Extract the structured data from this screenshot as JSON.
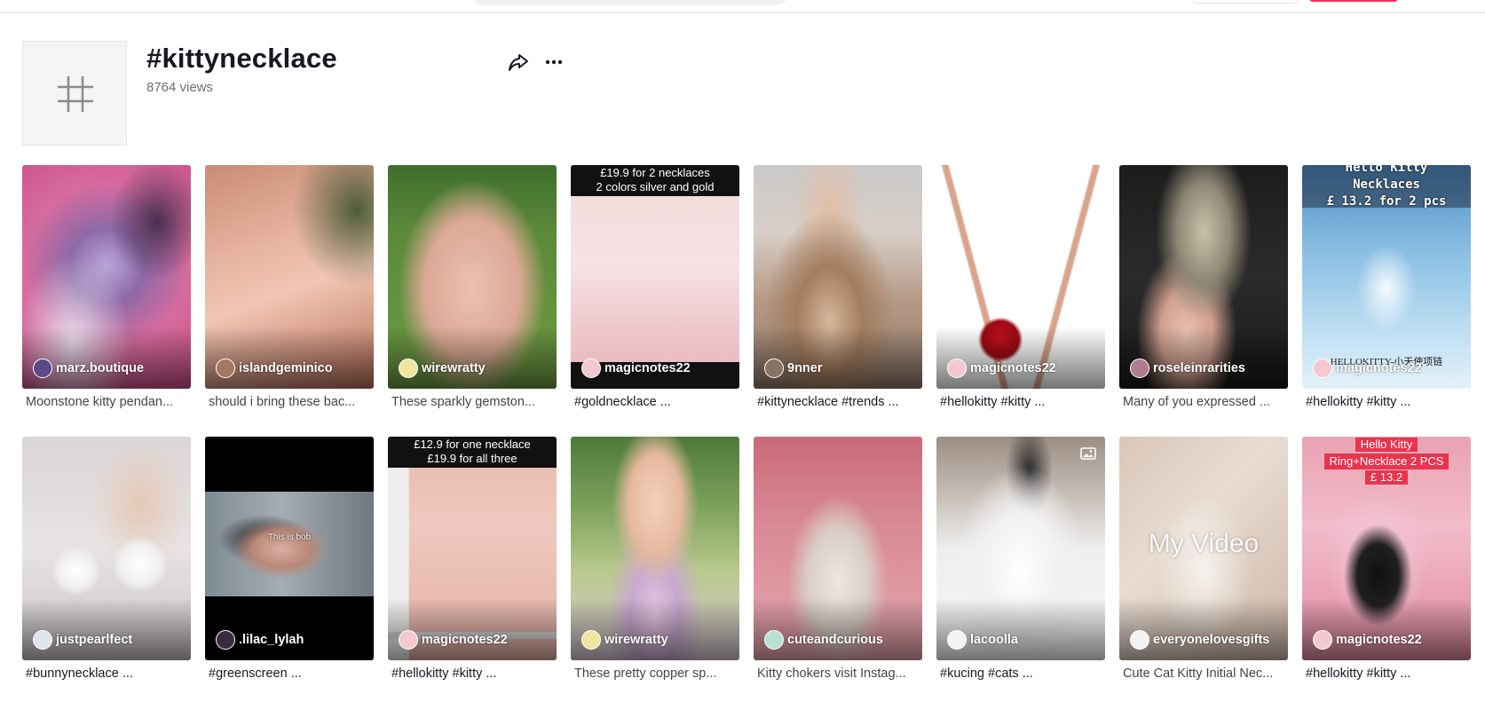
{
  "header": {
    "title": "#kittynecklace",
    "views": "8764 views"
  },
  "videos": [
    {
      "author": "marz.boutique",
      "caption": "Moonstone kitty pendan...",
      "overlay": ""
    },
    {
      "author": "islandgeminico",
      "caption": "should i bring these bac...",
      "overlay": ""
    },
    {
      "author": "wirewratty",
      "caption": "These sparkly gemston...",
      "overlay": ""
    },
    {
      "author": "magicnotes22",
      "caption": "#goldnecklace ...",
      "overlay_line1": "£19.9 for 2 necklaces",
      "overlay_line2": "2 colors silver and gold"
    },
    {
      "author": "9nner",
      "caption": "#kittynecklace #trends ...",
      "overlay": ""
    },
    {
      "author": "magicnotes22",
      "caption": "#hellokitty #kitty ...",
      "overlay": ""
    },
    {
      "author": "roseleinrarities",
      "caption": "Many of you expressed ...",
      "overlay": ""
    },
    {
      "author": "magicnotes22",
      "caption": "#hellokitty #kitty ...",
      "overlay_line1": "Hello Kitty",
      "overlay_line2": "Necklaces",
      "overlay_line3": "£ 13.2 for 2 pcs",
      "overlay_bottom": "HELLOKITTY-小天使项链"
    },
    {
      "author": "justpearlfect",
      "caption": "#bunnynecklace ...",
      "overlay": ""
    },
    {
      "author": ".lilac_lylah",
      "caption": "#greenscreen ...",
      "overlay_center": "This is bob"
    },
    {
      "author": "magicnotes22",
      "caption": "#hellokitty #kitty ...",
      "overlay_line1": "£12.9 for one necklace",
      "overlay_line2": "£19.9 for all three"
    },
    {
      "author": "wirewratty",
      "caption": "These pretty copper sp...",
      "overlay": ""
    },
    {
      "author": "cuteandcurious",
      "caption": "Kitty chokers visit Instag...",
      "overlay": ""
    },
    {
      "author": "lacoolla",
      "caption": "#kucing #cats ...",
      "overlay": ""
    },
    {
      "author": "everyonelovesgifts",
      "caption": "Cute Cat Kitty Initial Nec...",
      "overlay_center": "My Video"
    },
    {
      "author": "magicnotes22",
      "caption": "#hellokitty #kitty ...",
      "overlay_line1": "Hello Kitty",
      "overlay_line2": "Ring+Necklace 2 PCS",
      "overlay_line3": "£ 13.2"
    }
  ],
  "colors": {
    "accent": "#fe2c55",
    "text": "#161823",
    "muted": "#6b6d74"
  }
}
